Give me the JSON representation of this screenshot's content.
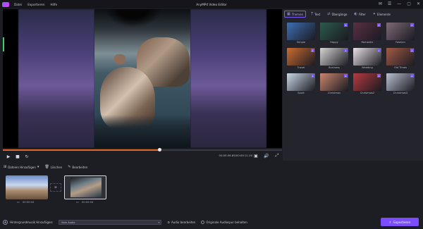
{
  "app": {
    "title": "AnyMP4 Video Editor"
  },
  "menu": [
    "Datei",
    "Exportieren",
    "Hilfe"
  ],
  "preview": {
    "timecode": "00:00:06.85/00:00:11.00",
    "progress": 0.56
  },
  "panel": {
    "tabs": [
      {
        "label": "Themen",
        "icon": "themes-icon",
        "active": true
      },
      {
        "label": "Text",
        "icon": "text-icon"
      },
      {
        "label": "Übergänge",
        "icon": "transitions-icon"
      },
      {
        "label": "Filter",
        "icon": "filter-icon"
      },
      {
        "label": "Elemente",
        "icon": "elements-icon"
      }
    ],
    "themes": [
      {
        "name": "Simple",
        "color": "#3d6fb3"
      },
      {
        "name": "Happy",
        "color": "#2c5a4c"
      },
      {
        "name": "Romantic",
        "color": "#5b2f43"
      },
      {
        "name": "Fashion",
        "color": "#7f6a76"
      },
      {
        "name": "Travel",
        "color": "#cc6c2f"
      },
      {
        "name": "Business",
        "color": "#d7d4d2"
      },
      {
        "name": "Wedding",
        "color": "#e9e1e6"
      },
      {
        "name": "Old Times",
        "color": "#a35a45"
      },
      {
        "name": "Sport",
        "color": "#c9d8e6"
      },
      {
        "name": "Christmas",
        "color": "#c9856d"
      },
      {
        "name": "Christmas2",
        "color": "#b53a3f"
      },
      {
        "name": "Christmas3",
        "color": "#b9c0d0"
      }
    ]
  },
  "toolbar": {
    "add_files": "Dateien Hinzufügen",
    "delete": "Löschen",
    "edit": "Bearbeiten"
  },
  "timeline": {
    "clips": [
      {
        "time": "00:00:04"
      },
      {
        "time": "00:00:04"
      }
    ]
  },
  "footer": {
    "add_music": "Hintergrundmusik Hinzufügen:",
    "audio_select": "Kein Audio",
    "audio_edit": "Audio bearbeiten",
    "keep_audio": "Originale Audiospur behalten",
    "export": "Exportieren"
  },
  "colors": {
    "accent": "#7b4dff",
    "progress": "#e06a2e"
  }
}
